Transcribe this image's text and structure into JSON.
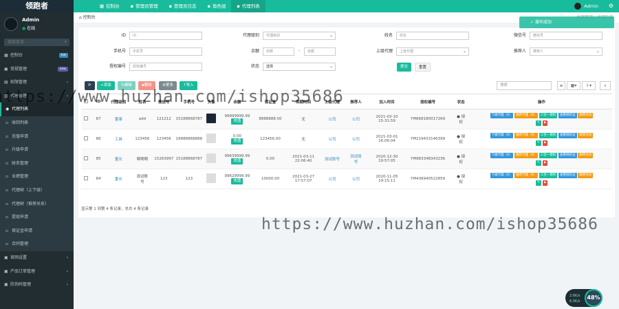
{
  "logo": "领跑者",
  "topbar": {
    "tabs": [
      {
        "label": "控制台",
        "active": false
      },
      {
        "label": "管理员管理",
        "active": false
      },
      {
        "label": "管理员日志",
        "active": false
      },
      {
        "label": "角色组",
        "active": false
      },
      {
        "label": "代理列表",
        "active": true
      }
    ],
    "admin": "Admin"
  },
  "sidebar": {
    "user_name": "Admin",
    "user_status": "在线",
    "search_placeholder": "搜索菜单",
    "items": [
      {
        "label": "控制台",
        "badge": "hot",
        "badge_color": "#3c8dbc"
      },
      {
        "label": "常规管理",
        "badge": "new",
        "badge_color": "#605ca8"
      },
      {
        "label": "权限管理",
        "arrow": "‹"
      },
      {
        "label": "代理管理",
        "arrow": "‹"
      },
      {
        "label": "代理列表",
        "active": true
      },
      {
        "label": "收回列表",
        "sub": true
      },
      {
        "label": "充值申请",
        "sub": true
      },
      {
        "label": "升级申请",
        "sub": true
      },
      {
        "label": "财务管理",
        "sub": true
      },
      {
        "label": "业绩管理",
        "sub": true
      },
      {
        "label": "代理树（上下级）",
        "sub": true
      },
      {
        "label": "代理树（推荐关系）",
        "sub": true
      },
      {
        "label": "提现申请",
        "sub": true
      },
      {
        "label": "保证金申请",
        "sub": true
      },
      {
        "label": "合同管理",
        "sub": true
      },
      {
        "label": "官网设置",
        "arrow": "‹"
      },
      {
        "label": "产品订单管理",
        "arrow": "‹"
      },
      {
        "label": "防伪码管理",
        "arrow": "‹"
      }
    ]
  },
  "breadcrumb": {
    "title": "控制台",
    "right": "代理管理 / 代理列表"
  },
  "toast": "操作成功",
  "filters": {
    "row1": [
      {
        "label": "ID",
        "placeholder": "ID"
      },
      {
        "label": "代理级别",
        "placeholder": "代理级别",
        "select": true
      },
      {
        "label": "姓名",
        "placeholder": "姓名"
      },
      {
        "label": "微信号",
        "placeholder": "微信号"
      }
    ],
    "row2": [
      {
        "label": "手机号",
        "placeholder": "手机号"
      },
      {
        "label": "余额",
        "placeholder": "余额",
        "placeholder2": "余额"
      },
      {
        "label": "上级代理",
        "placeholder": "上级代理",
        "select": true
      },
      {
        "label": "推荐人",
        "placeholder": "推荐人",
        "select": true
      }
    ],
    "row3": [
      {
        "label": "授权编号",
        "placeholder": "授权编号"
      },
      {
        "label": "状态",
        "placeholder": "选择",
        "select": true
      }
    ],
    "submit": "提交",
    "reset": "重置"
  },
  "toolbar": {
    "refresh": "⟳",
    "add": "添加",
    "edit": "编辑",
    "delete": "删除",
    "more": "更多",
    "import": "导入",
    "search_placeholder": "搜索"
  },
  "table": {
    "headers": [
      "",
      "ID",
      "代理级别",
      "姓名",
      "微信号",
      "手机号",
      "头像",
      "余额",
      "保证金",
      "到期时间",
      "上级代理",
      "推荐人",
      "加入时间",
      "授权编号",
      "状态",
      "操作"
    ],
    "rows": [
      {
        "id": "87",
        "level": "董事",
        "name": "add",
        "wechat": "121212",
        "phone": "15188868787",
        "avatar_dark": true,
        "balance": "99999999.99",
        "balance_tag": "充值",
        "deposit": "8888888.00",
        "expire": "无",
        "parent": "公司",
        "referrer": "公司",
        "joined1": "2021-03-10",
        "joined2": "15:31:59",
        "auth": "YM668180017269",
        "status1": "● 授",
        "status2": "权"
      },
      {
        "id": "86",
        "level": "工具",
        "name": "123456",
        "wechat": "123456",
        "phone": "16888868888",
        "avatar_dark": false,
        "balance": "0.00",
        "balance_tag": "充值",
        "deposit": "123456.00",
        "expire": "无",
        "parent": "公司",
        "referrer": "公司",
        "joined1": "2021-03-01",
        "joined2": "16:06:04",
        "auth": "YM219433146399",
        "status1": "● 授",
        "status2": "权"
      },
      {
        "id": "85",
        "level": "董长",
        "name": "啊啊啊",
        "wechat": "15263997",
        "phone": "15188868787",
        "avatar_dark": false,
        "balance": "99639999.99",
        "balance_tag": "充值",
        "deposit": "0.00",
        "expire1": "2021-03-11",
        "expire2": "22:06:40",
        "parent": "测试账号",
        "referrer1": "测试账",
        "referrer2": "号",
        "joined1": "2020-12-30",
        "joined2": "19:57:05",
        "auth": "YM983348343236",
        "status1": "● 授",
        "status2": "权"
      },
      {
        "id": "84",
        "level": "董长",
        "name1": "测试账",
        "name2": "号",
        "wechat": "123",
        "phone": "123",
        "avatar_dark": false,
        "balance": "99629999.99",
        "balance_tag": "充值",
        "deposit": "10000.00",
        "expire1": "2021-03-27",
        "expire2": "17:57:07",
        "parent": "公司",
        "referrer": "公司",
        "joined1": "2020-11-05",
        "joined2": "19:15:11",
        "auth": "YM436940522859",
        "status1": "● 授",
        "status2": "权"
      }
    ],
    "actions": {
      "a1": "下级代理（0）",
      "a2": "推荐代理（0）",
      "a3": "三合一授权",
      "a4": "查看授权证",
      "a5": "跳转合同"
    },
    "summary": "显示第 1 到第 4 条记录，总共 4 条记录"
  },
  "watermark1": "https://www.huzhan.com/ishop35686",
  "watermark2": "https://www.huzhan.com/ishop35686",
  "speed": {
    "percent": "48%",
    "up": "2.6K/s",
    "down": "6.0K/s"
  }
}
